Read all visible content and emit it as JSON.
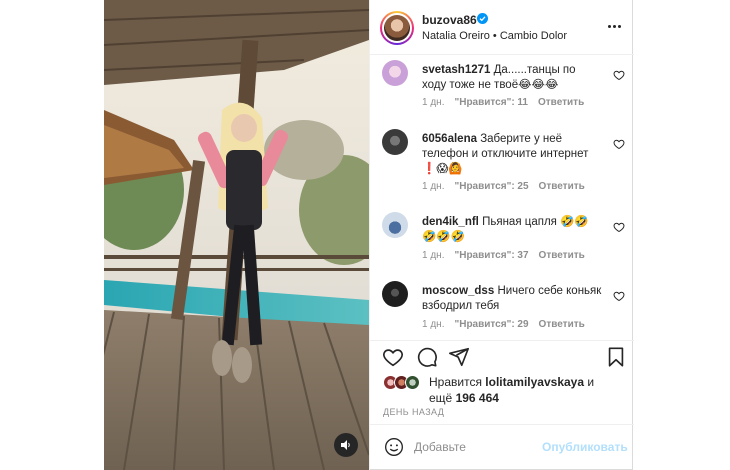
{
  "post": {
    "username": "buzova86",
    "verified": true,
    "audio": "Natalia Oreiro • Cambio Dolor",
    "more_icon": "more-horizontal-icon",
    "sound_icon": "speaker-icon"
  },
  "comments": [
    {
      "username": "svetash1271",
      "text": "Да......танцы по ходу тоже не твоё😂😂😂",
      "age": "1 дн.",
      "likes": "\"Нравится\": 11",
      "reply": "Ответить",
      "avatar_color": "#c9a0d8"
    },
    {
      "username": "6056alena",
      "text": "Заберите у неё телефон и отключите интернет ❗😱🙆",
      "age": "1 дн.",
      "likes": "\"Нравится\": 25",
      "reply": "Ответить",
      "avatar_color": "#3a3a3a"
    },
    {
      "username": "den4ik_nfl",
      "text": "Пьяная цапля 🤣🤣🤣🤣🤣",
      "age": "1 дн.",
      "likes": "\"Нравится\": 37",
      "reply": "Ответить",
      "avatar_color": "#9ab4cf"
    },
    {
      "username": "moscow_dss",
      "text": "Ничего себе коньяк взбодрил тебя",
      "age": "1 дн.",
      "likes": "\"Нравится\": 29",
      "reply": "Ответить",
      "avatar_color": "#1e1e1e"
    }
  ],
  "actions": {
    "like_icon": "heart-icon",
    "comment_icon": "comment-icon",
    "share_icon": "share-icon",
    "save_icon": "bookmark-icon"
  },
  "likes": {
    "prefix": "Нравится",
    "user": "lolitamilyavskaya",
    "conjunction": "и",
    "more_prefix": "ещё",
    "count": "196 464"
  },
  "timestamp": "ДЕНЬ НАЗАД",
  "add_comment": {
    "placeholder": "Добавьте",
    "publish": "Опубликовать"
  },
  "colors": {
    "accent": "#0095f6",
    "publish_disabled": "#b2dffc",
    "muted": "#8e8e8e",
    "text": "#262626"
  }
}
